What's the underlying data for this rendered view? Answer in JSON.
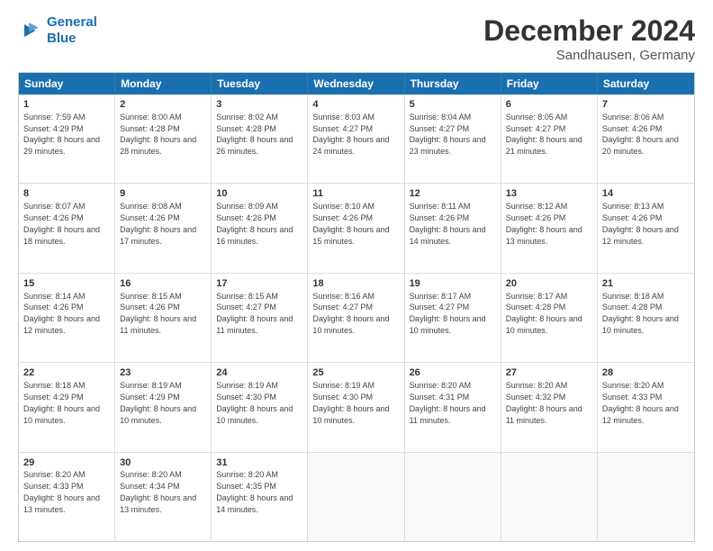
{
  "logo": {
    "line1": "General",
    "line2": "Blue"
  },
  "title": "December 2024",
  "subtitle": "Sandhausen, Germany",
  "header_days": [
    "Sunday",
    "Monday",
    "Tuesday",
    "Wednesday",
    "Thursday",
    "Friday",
    "Saturday"
  ],
  "weeks": [
    [
      {
        "day": "1",
        "sunrise": "7:59 AM",
        "sunset": "4:29 PM",
        "daylight": "8 hours and 29 minutes."
      },
      {
        "day": "2",
        "sunrise": "8:00 AM",
        "sunset": "4:28 PM",
        "daylight": "8 hours and 28 minutes."
      },
      {
        "day": "3",
        "sunrise": "8:02 AM",
        "sunset": "4:28 PM",
        "daylight": "8 hours and 26 minutes."
      },
      {
        "day": "4",
        "sunrise": "8:03 AM",
        "sunset": "4:27 PM",
        "daylight": "8 hours and 24 minutes."
      },
      {
        "day": "5",
        "sunrise": "8:04 AM",
        "sunset": "4:27 PM",
        "daylight": "8 hours and 23 minutes."
      },
      {
        "day": "6",
        "sunrise": "8:05 AM",
        "sunset": "4:27 PM",
        "daylight": "8 hours and 21 minutes."
      },
      {
        "day": "7",
        "sunrise": "8:06 AM",
        "sunset": "4:26 PM",
        "daylight": "8 hours and 20 minutes."
      }
    ],
    [
      {
        "day": "8",
        "sunrise": "8:07 AM",
        "sunset": "4:26 PM",
        "daylight": "8 hours and 18 minutes."
      },
      {
        "day": "9",
        "sunrise": "8:08 AM",
        "sunset": "4:26 PM",
        "daylight": "8 hours and 17 minutes."
      },
      {
        "day": "10",
        "sunrise": "8:09 AM",
        "sunset": "4:26 PM",
        "daylight": "8 hours and 16 minutes."
      },
      {
        "day": "11",
        "sunrise": "8:10 AM",
        "sunset": "4:26 PM",
        "daylight": "8 hours and 15 minutes."
      },
      {
        "day": "12",
        "sunrise": "8:11 AM",
        "sunset": "4:26 PM",
        "daylight": "8 hours and 14 minutes."
      },
      {
        "day": "13",
        "sunrise": "8:12 AM",
        "sunset": "4:26 PM",
        "daylight": "8 hours and 13 minutes."
      },
      {
        "day": "14",
        "sunrise": "8:13 AM",
        "sunset": "4:26 PM",
        "daylight": "8 hours and 12 minutes."
      }
    ],
    [
      {
        "day": "15",
        "sunrise": "8:14 AM",
        "sunset": "4:26 PM",
        "daylight": "8 hours and 12 minutes."
      },
      {
        "day": "16",
        "sunrise": "8:15 AM",
        "sunset": "4:26 PM",
        "daylight": "8 hours and 11 minutes."
      },
      {
        "day": "17",
        "sunrise": "8:15 AM",
        "sunset": "4:27 PM",
        "daylight": "8 hours and 11 minutes."
      },
      {
        "day": "18",
        "sunrise": "8:16 AM",
        "sunset": "4:27 PM",
        "daylight": "8 hours and 10 minutes."
      },
      {
        "day": "19",
        "sunrise": "8:17 AM",
        "sunset": "4:27 PM",
        "daylight": "8 hours and 10 minutes."
      },
      {
        "day": "20",
        "sunrise": "8:17 AM",
        "sunset": "4:28 PM",
        "daylight": "8 hours and 10 minutes."
      },
      {
        "day": "21",
        "sunrise": "8:18 AM",
        "sunset": "4:28 PM",
        "daylight": "8 hours and 10 minutes."
      }
    ],
    [
      {
        "day": "22",
        "sunrise": "8:18 AM",
        "sunset": "4:29 PM",
        "daylight": "8 hours and 10 minutes."
      },
      {
        "day": "23",
        "sunrise": "8:19 AM",
        "sunset": "4:29 PM",
        "daylight": "8 hours and 10 minutes."
      },
      {
        "day": "24",
        "sunrise": "8:19 AM",
        "sunset": "4:30 PM",
        "daylight": "8 hours and 10 minutes."
      },
      {
        "day": "25",
        "sunrise": "8:19 AM",
        "sunset": "4:30 PM",
        "daylight": "8 hours and 10 minutes."
      },
      {
        "day": "26",
        "sunrise": "8:20 AM",
        "sunset": "4:31 PM",
        "daylight": "8 hours and 11 minutes."
      },
      {
        "day": "27",
        "sunrise": "8:20 AM",
        "sunset": "4:32 PM",
        "daylight": "8 hours and 11 minutes."
      },
      {
        "day": "28",
        "sunrise": "8:20 AM",
        "sunset": "4:33 PM",
        "daylight": "8 hours and 12 minutes."
      }
    ],
    [
      {
        "day": "29",
        "sunrise": "8:20 AM",
        "sunset": "4:33 PM",
        "daylight": "8 hours and 13 minutes."
      },
      {
        "day": "30",
        "sunrise": "8:20 AM",
        "sunset": "4:34 PM",
        "daylight": "8 hours and 13 minutes."
      },
      {
        "day": "31",
        "sunrise": "8:20 AM",
        "sunset": "4:35 PM",
        "daylight": "8 hours and 14 minutes."
      },
      null,
      null,
      null,
      null
    ]
  ]
}
